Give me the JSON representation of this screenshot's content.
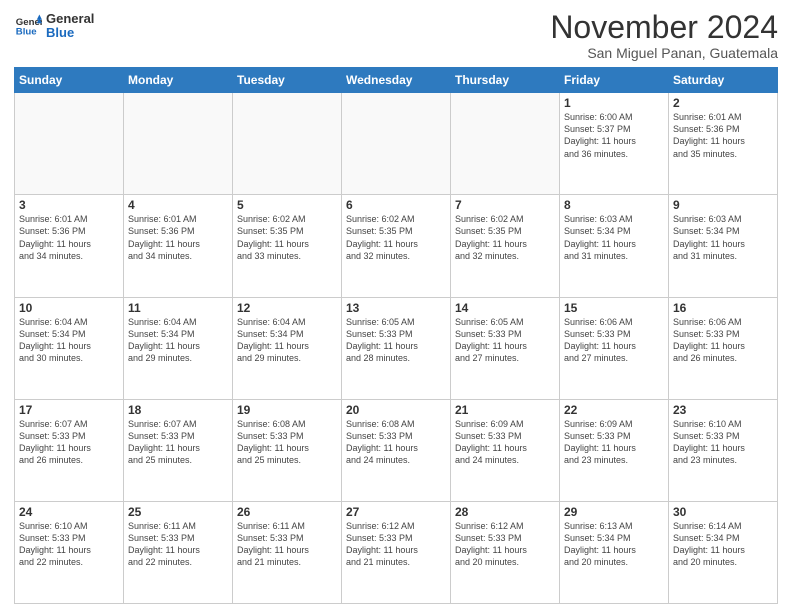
{
  "header": {
    "logo_line1": "General",
    "logo_line2": "Blue",
    "month_title": "November 2024",
    "location": "San Miguel Panan, Guatemala"
  },
  "days_of_week": [
    "Sunday",
    "Monday",
    "Tuesday",
    "Wednesday",
    "Thursday",
    "Friday",
    "Saturday"
  ],
  "weeks": [
    [
      {
        "day": "",
        "info": ""
      },
      {
        "day": "",
        "info": ""
      },
      {
        "day": "",
        "info": ""
      },
      {
        "day": "",
        "info": ""
      },
      {
        "day": "",
        "info": ""
      },
      {
        "day": "1",
        "info": "Sunrise: 6:00 AM\nSunset: 5:37 PM\nDaylight: 11 hours\nand 36 minutes."
      },
      {
        "day": "2",
        "info": "Sunrise: 6:01 AM\nSunset: 5:36 PM\nDaylight: 11 hours\nand 35 minutes."
      }
    ],
    [
      {
        "day": "3",
        "info": "Sunrise: 6:01 AM\nSunset: 5:36 PM\nDaylight: 11 hours\nand 34 minutes."
      },
      {
        "day": "4",
        "info": "Sunrise: 6:01 AM\nSunset: 5:36 PM\nDaylight: 11 hours\nand 34 minutes."
      },
      {
        "day": "5",
        "info": "Sunrise: 6:02 AM\nSunset: 5:35 PM\nDaylight: 11 hours\nand 33 minutes."
      },
      {
        "day": "6",
        "info": "Sunrise: 6:02 AM\nSunset: 5:35 PM\nDaylight: 11 hours\nand 32 minutes."
      },
      {
        "day": "7",
        "info": "Sunrise: 6:02 AM\nSunset: 5:35 PM\nDaylight: 11 hours\nand 32 minutes."
      },
      {
        "day": "8",
        "info": "Sunrise: 6:03 AM\nSunset: 5:34 PM\nDaylight: 11 hours\nand 31 minutes."
      },
      {
        "day": "9",
        "info": "Sunrise: 6:03 AM\nSunset: 5:34 PM\nDaylight: 11 hours\nand 31 minutes."
      }
    ],
    [
      {
        "day": "10",
        "info": "Sunrise: 6:04 AM\nSunset: 5:34 PM\nDaylight: 11 hours\nand 30 minutes."
      },
      {
        "day": "11",
        "info": "Sunrise: 6:04 AM\nSunset: 5:34 PM\nDaylight: 11 hours\nand 29 minutes."
      },
      {
        "day": "12",
        "info": "Sunrise: 6:04 AM\nSunset: 5:34 PM\nDaylight: 11 hours\nand 29 minutes."
      },
      {
        "day": "13",
        "info": "Sunrise: 6:05 AM\nSunset: 5:33 PM\nDaylight: 11 hours\nand 28 minutes."
      },
      {
        "day": "14",
        "info": "Sunrise: 6:05 AM\nSunset: 5:33 PM\nDaylight: 11 hours\nand 27 minutes."
      },
      {
        "day": "15",
        "info": "Sunrise: 6:06 AM\nSunset: 5:33 PM\nDaylight: 11 hours\nand 27 minutes."
      },
      {
        "day": "16",
        "info": "Sunrise: 6:06 AM\nSunset: 5:33 PM\nDaylight: 11 hours\nand 26 minutes."
      }
    ],
    [
      {
        "day": "17",
        "info": "Sunrise: 6:07 AM\nSunset: 5:33 PM\nDaylight: 11 hours\nand 26 minutes."
      },
      {
        "day": "18",
        "info": "Sunrise: 6:07 AM\nSunset: 5:33 PM\nDaylight: 11 hours\nand 25 minutes."
      },
      {
        "day": "19",
        "info": "Sunrise: 6:08 AM\nSunset: 5:33 PM\nDaylight: 11 hours\nand 25 minutes."
      },
      {
        "day": "20",
        "info": "Sunrise: 6:08 AM\nSunset: 5:33 PM\nDaylight: 11 hours\nand 24 minutes."
      },
      {
        "day": "21",
        "info": "Sunrise: 6:09 AM\nSunset: 5:33 PM\nDaylight: 11 hours\nand 24 minutes."
      },
      {
        "day": "22",
        "info": "Sunrise: 6:09 AM\nSunset: 5:33 PM\nDaylight: 11 hours\nand 23 minutes."
      },
      {
        "day": "23",
        "info": "Sunrise: 6:10 AM\nSunset: 5:33 PM\nDaylight: 11 hours\nand 23 minutes."
      }
    ],
    [
      {
        "day": "24",
        "info": "Sunrise: 6:10 AM\nSunset: 5:33 PM\nDaylight: 11 hours\nand 22 minutes."
      },
      {
        "day": "25",
        "info": "Sunrise: 6:11 AM\nSunset: 5:33 PM\nDaylight: 11 hours\nand 22 minutes."
      },
      {
        "day": "26",
        "info": "Sunrise: 6:11 AM\nSunset: 5:33 PM\nDaylight: 11 hours\nand 21 minutes."
      },
      {
        "day": "27",
        "info": "Sunrise: 6:12 AM\nSunset: 5:33 PM\nDaylight: 11 hours\nand 21 minutes."
      },
      {
        "day": "28",
        "info": "Sunrise: 6:12 AM\nSunset: 5:33 PM\nDaylight: 11 hours\nand 20 minutes."
      },
      {
        "day": "29",
        "info": "Sunrise: 6:13 AM\nSunset: 5:34 PM\nDaylight: 11 hours\nand 20 minutes."
      },
      {
        "day": "30",
        "info": "Sunrise: 6:14 AM\nSunset: 5:34 PM\nDaylight: 11 hours\nand 20 minutes."
      }
    ]
  ]
}
